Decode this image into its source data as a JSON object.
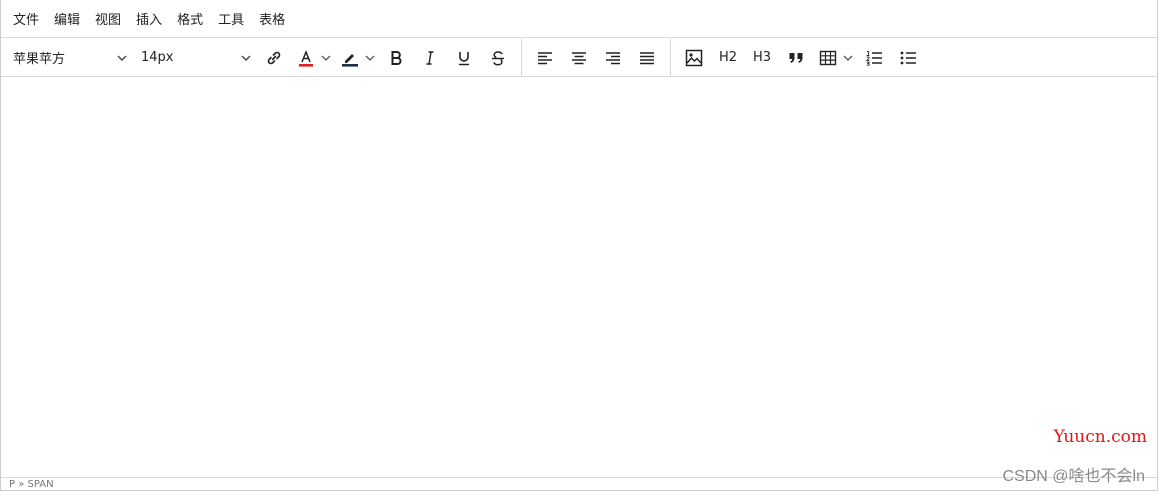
{
  "menubar": {
    "items": [
      "文件",
      "编辑",
      "视图",
      "插入",
      "格式",
      "工具",
      "表格"
    ]
  },
  "toolbar": {
    "font_family": "苹果苹方",
    "font_size": "14px",
    "h2_label": "H2",
    "h3_label": "H3",
    "text_color": "#e02020",
    "highlight_color": "#222f3e"
  },
  "icons": {
    "link": "link-icon",
    "text_color": "text-color-icon",
    "highlight": "highlight-icon",
    "bold": "bold-icon",
    "italic": "italic-icon",
    "underline": "underline-icon",
    "strikethrough": "strikethrough-icon",
    "align_left": "align-left-icon",
    "align_center": "align-center-icon",
    "align_right": "align-right-icon",
    "align_justify": "align-justify-icon",
    "image": "image-icon",
    "blockquote": "blockquote-icon",
    "table": "table-icon",
    "numbered_list": "numbered-list-icon",
    "bullet_list": "bullet-list-icon"
  },
  "statusbar": {
    "path": "P » SPAN"
  },
  "watermarks": {
    "site": "Yuucn.com",
    "author": "CSDN @啥也不会ln"
  }
}
